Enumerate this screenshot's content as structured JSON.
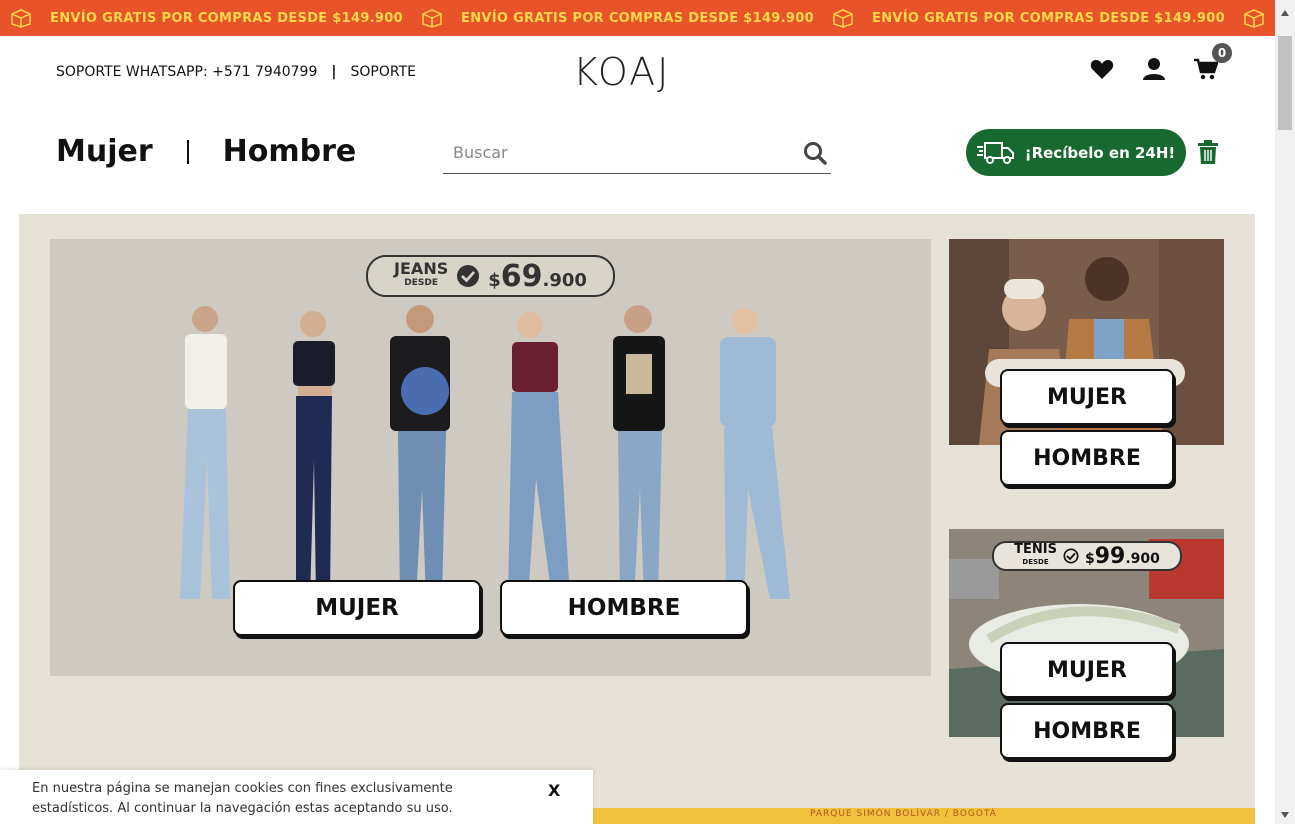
{
  "promo": {
    "message": "ENVÍO GRATIS POR COMPRAS DESDE $149.900",
    "icon": "box-icon"
  },
  "header": {
    "support_whatsapp": "SOPORTE WHATSAPP: +571 7940799",
    "separator": "|",
    "support_link": "SOPORTE",
    "logo": "KOAJ",
    "cart_count": "0",
    "icons": [
      "heart-icon",
      "user-icon",
      "cart-icon"
    ]
  },
  "nav": {
    "women": "Mujer",
    "men": "Hombre"
  },
  "search": {
    "placeholder": "Buscar"
  },
  "fast_delivery": {
    "label": "¡Recíbelo en 24H!"
  },
  "banner_main": {
    "badge_label": "JEANS",
    "badge_sub": "DESDE",
    "price_currency": "$",
    "price_big": "69",
    "price_small": ".900",
    "cta_women": "MUJER",
    "cta_men": "HOMBRE"
  },
  "banner_side1": {
    "cta_women": "MUJER",
    "cta_men": "HOMBRE"
  },
  "banner_side2": {
    "badge_label": "TENIS",
    "badge_sub": "DESDE",
    "price_currency": "$",
    "price_big": "99",
    "price_small": ".900",
    "cta_women": "MUJER",
    "cta_men": "HOMBRE"
  },
  "cookie": {
    "text": "En nuestra página se manejan cookies con fines exclusivamente estadísticos. Al continuar la navegación estas aceptando su uso.",
    "close": "X"
  },
  "bottom_strip": {
    "text": "PARQUE SIMÓN BOLÍVAR / BOGOTÁ"
  },
  "colors": {
    "promo_bg": "#e8532a",
    "promo_text": "#ffd94a",
    "delivery_green": "#17692f",
    "hero_bg": "#e7e2d8"
  }
}
